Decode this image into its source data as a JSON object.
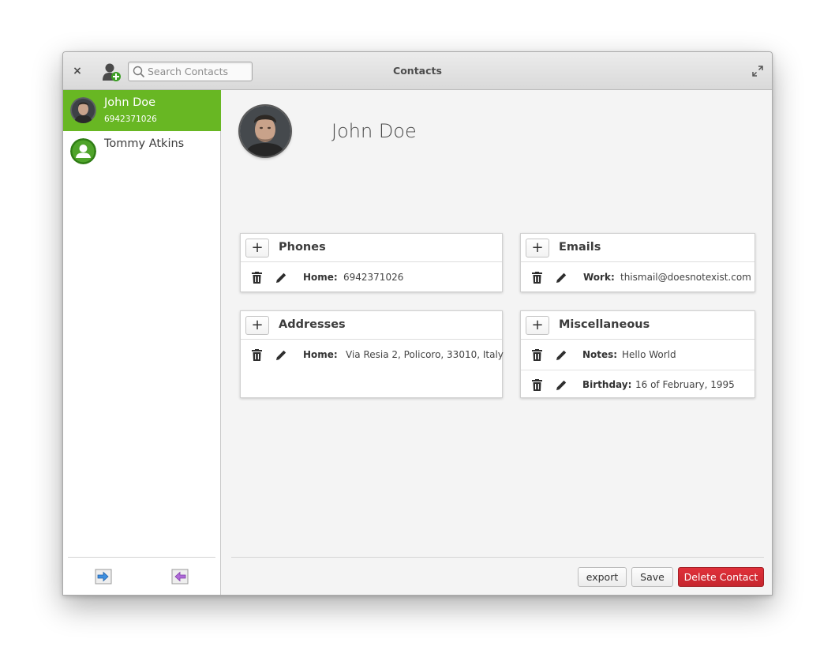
{
  "window": {
    "title": "Contacts",
    "close_label": "×"
  },
  "search": {
    "placeholder": "Search Contacts",
    "value": ""
  },
  "sidebar": {
    "contacts": [
      {
        "name": "John Doe",
        "subtitle": "6942371026",
        "selected": true
      },
      {
        "name": "Tommy Atkins",
        "subtitle": "",
        "selected": false
      }
    ]
  },
  "detail": {
    "name": "John Doe",
    "sections": [
      {
        "title": "Phones",
        "rows": [
          {
            "label": "Home:",
            "value": "6942371026"
          }
        ]
      },
      {
        "title": "Emails",
        "rows": [
          {
            "label": "Work:",
            "value": "thismail@doesnotexist.com"
          }
        ]
      },
      {
        "title": "Addresses",
        "rows": [
          {
            "label": "Home:",
            "value": "Via Resia 2, Policoro, 33010, Italy"
          }
        ]
      },
      {
        "title": "Miscellaneous",
        "rows": [
          {
            "label": "Notes:",
            "value": "Hello World"
          },
          {
            "label": "Birthday:",
            "value": "16 of February, 1995"
          }
        ]
      }
    ],
    "add_label": "+"
  },
  "footer": {
    "export_label": "export",
    "save_label": "Save",
    "delete_label": "Delete Contact"
  },
  "colors": {
    "accent_green": "#68b723",
    "danger_red": "#c6262e"
  },
  "icons": [
    "close-icon",
    "add-contact-icon",
    "search-icon",
    "maximize-icon",
    "trash-icon",
    "pencil-icon",
    "import-icon",
    "export-icon",
    "avatar-icon"
  ]
}
